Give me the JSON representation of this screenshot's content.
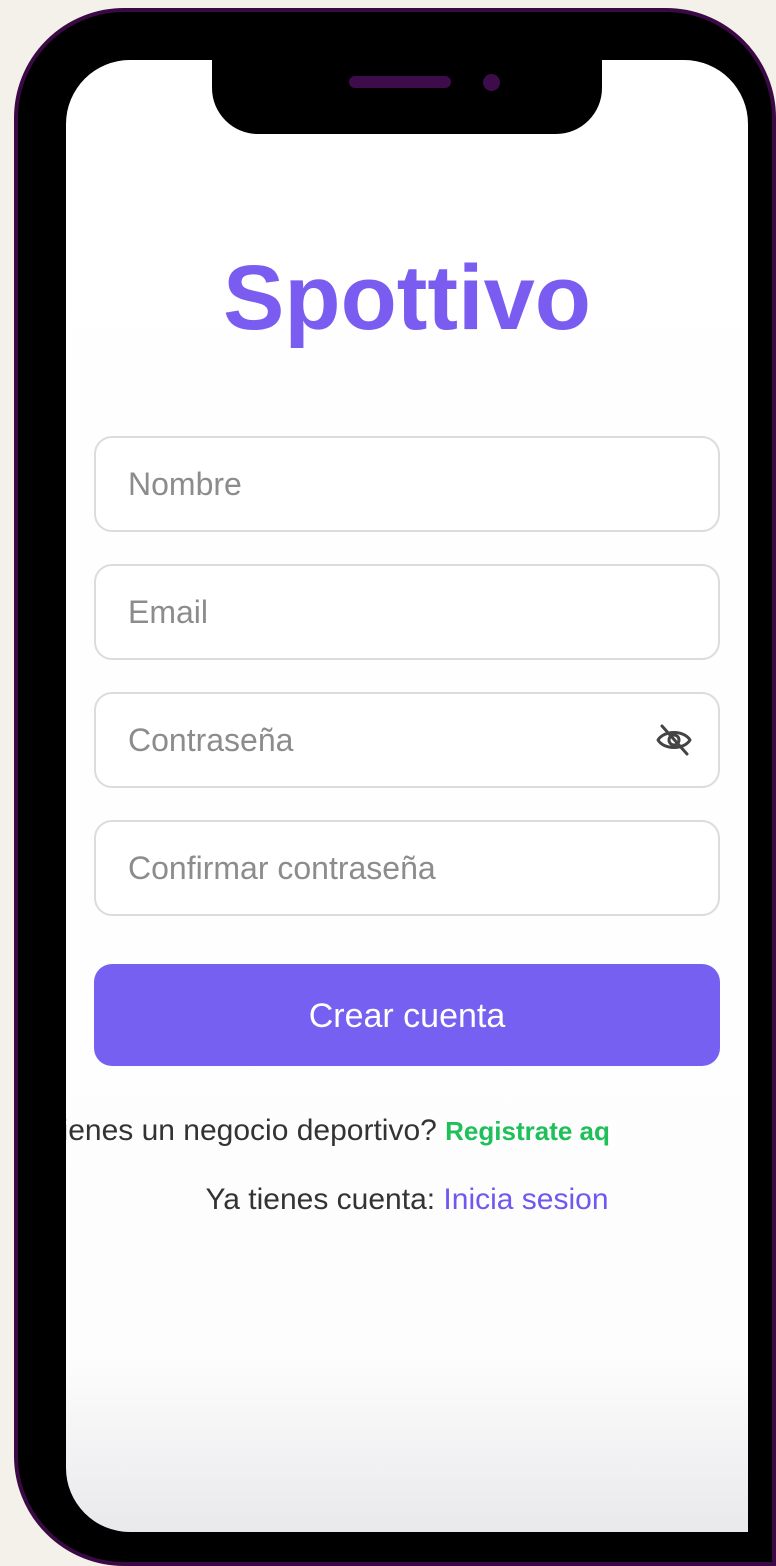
{
  "app": {
    "logo_text": "Spottivo"
  },
  "form": {
    "name_placeholder": "Nombre",
    "email_placeholder": "Email",
    "password_placeholder": "Contraseña",
    "confirm_password_placeholder": "Confirmar contraseña",
    "submit_label": "Crear cuenta"
  },
  "business_prompt": {
    "text": "¿Tienes un negocio deportivo? ",
    "link": "Registrate aq"
  },
  "login_prompt": {
    "text": "Ya tienes cuenta: ",
    "link": "Inicia sesion"
  },
  "icons": {
    "password_toggle": "eye-off-icon"
  },
  "colors": {
    "brand": "#7b5cf0",
    "button": "#7660f2",
    "register_link": "#1fbf5a",
    "login_link": "#6f58f0",
    "phone_frame": "#3b0a45"
  }
}
